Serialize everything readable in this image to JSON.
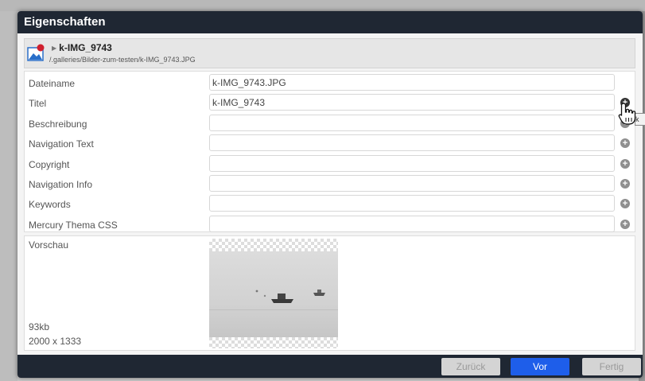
{
  "dialog": {
    "title": "Eigenschaften"
  },
  "file": {
    "name": "k-IMG_9743",
    "path": "/.galleries/Bilder-zum-testen/k-IMG_9743.JPG",
    "icon": "image-file-icon"
  },
  "fields": [
    {
      "label": "Dateiname",
      "value": "k-IMG_9743.JPG",
      "add_button": false
    },
    {
      "label": "Titel",
      "value": "k-IMG_9743",
      "add_button": true
    },
    {
      "label": "Beschreibung",
      "value": "",
      "add_button": true
    },
    {
      "label": "Navigation Text",
      "value": "",
      "add_button": true
    },
    {
      "label": "Copyright",
      "value": "",
      "add_button": true
    },
    {
      "label": "Navigation Info",
      "value": "",
      "add_button": true
    },
    {
      "label": "Keywords",
      "value": "",
      "add_button": true
    },
    {
      "label": "Mercury Thema CSS",
      "value": "",
      "add_button": true
    }
  ],
  "add_icon": "plus-circle-icon",
  "preview": {
    "label": "Vorschau",
    "size": "93kb",
    "dimensions": "2000 x 1333"
  },
  "footer": {
    "back_label": "Zurück",
    "next_label": "Vor",
    "done_label": "Fertig"
  },
  "tooltip_fragment": "k",
  "colors": {
    "titlebar": "#1f2733",
    "primary_button": "#1e5eea",
    "disabled_button": "#d4d4d4"
  }
}
